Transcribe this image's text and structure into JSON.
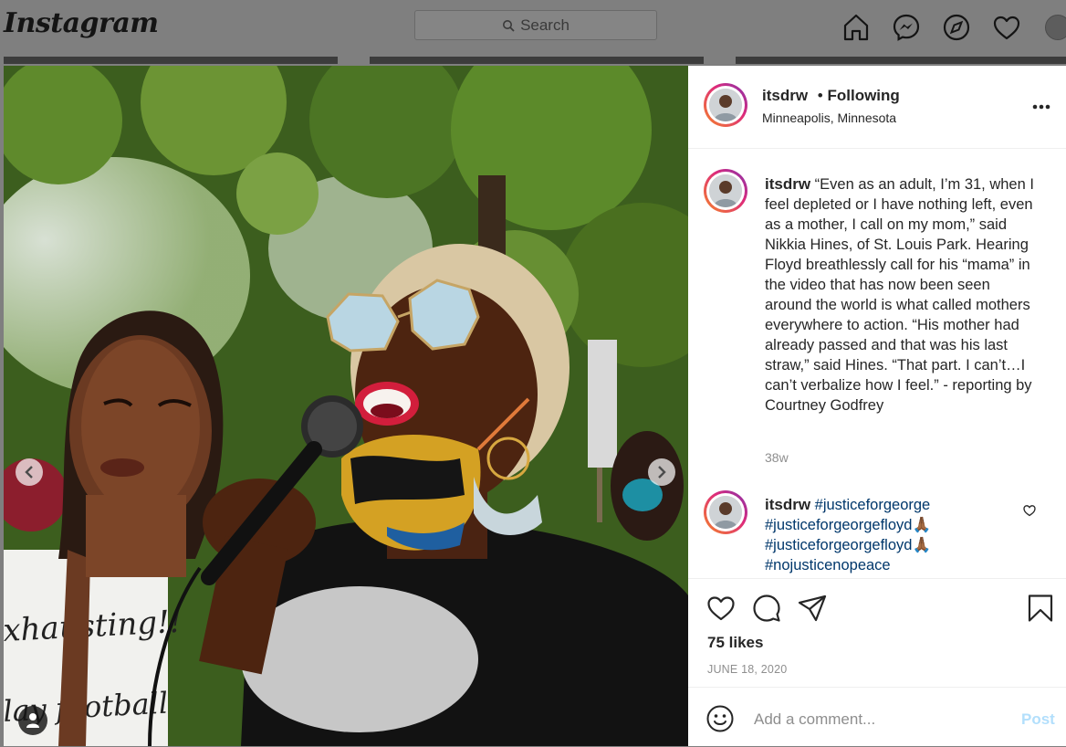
{
  "brand": {
    "logo": "Instagram"
  },
  "search": {
    "placeholder": "Search"
  },
  "nav": {
    "icons": [
      "home-icon",
      "messenger-icon",
      "explore-icon",
      "activity-heart-icon",
      "profile-avatar"
    ]
  },
  "post": {
    "author": "itsdrw",
    "follow_status": "Following",
    "location": "Minneapolis, Minnesota",
    "photo_sign_text_1": "xhausting!!",
    "photo_sign_text_2": "lay football"
  },
  "caption": {
    "username": "itsdrw",
    "text": "“Even as an adult, I’m 31, when I feel depleted or I have nothing left, even as a mother, I call on my mom,” said Nikkia Hines, of St. Louis Park. Hearing Floyd breathlessly call for his “mama” in the video that has now been seen around the world is what called mothers everywhere to action. “His mother had already passed and that was his last straw,” said Hines. “That part. I can’t…I can’t verbalize how I feel.” - reporting by Courtney Godfrey",
    "time": "38w"
  },
  "comment": {
    "username": "itsdrw",
    "tags": [
      "#justiceforgeorge",
      "#justiceforgeorgefloyd",
      "#justiceforgeorgefloyd",
      "#nojusticenopeace"
    ],
    "emoji": "🙏🏾"
  },
  "engagement": {
    "likes": "75 likes",
    "date": "JUNE 18, 2020"
  },
  "composer": {
    "placeholder": "Add a comment...",
    "post_label": "Post"
  },
  "colors": {
    "link": "#00376b",
    "post_button": "#b2dffc",
    "accent_ring_start": "#f58529",
    "accent_ring_end": "#8134af"
  }
}
